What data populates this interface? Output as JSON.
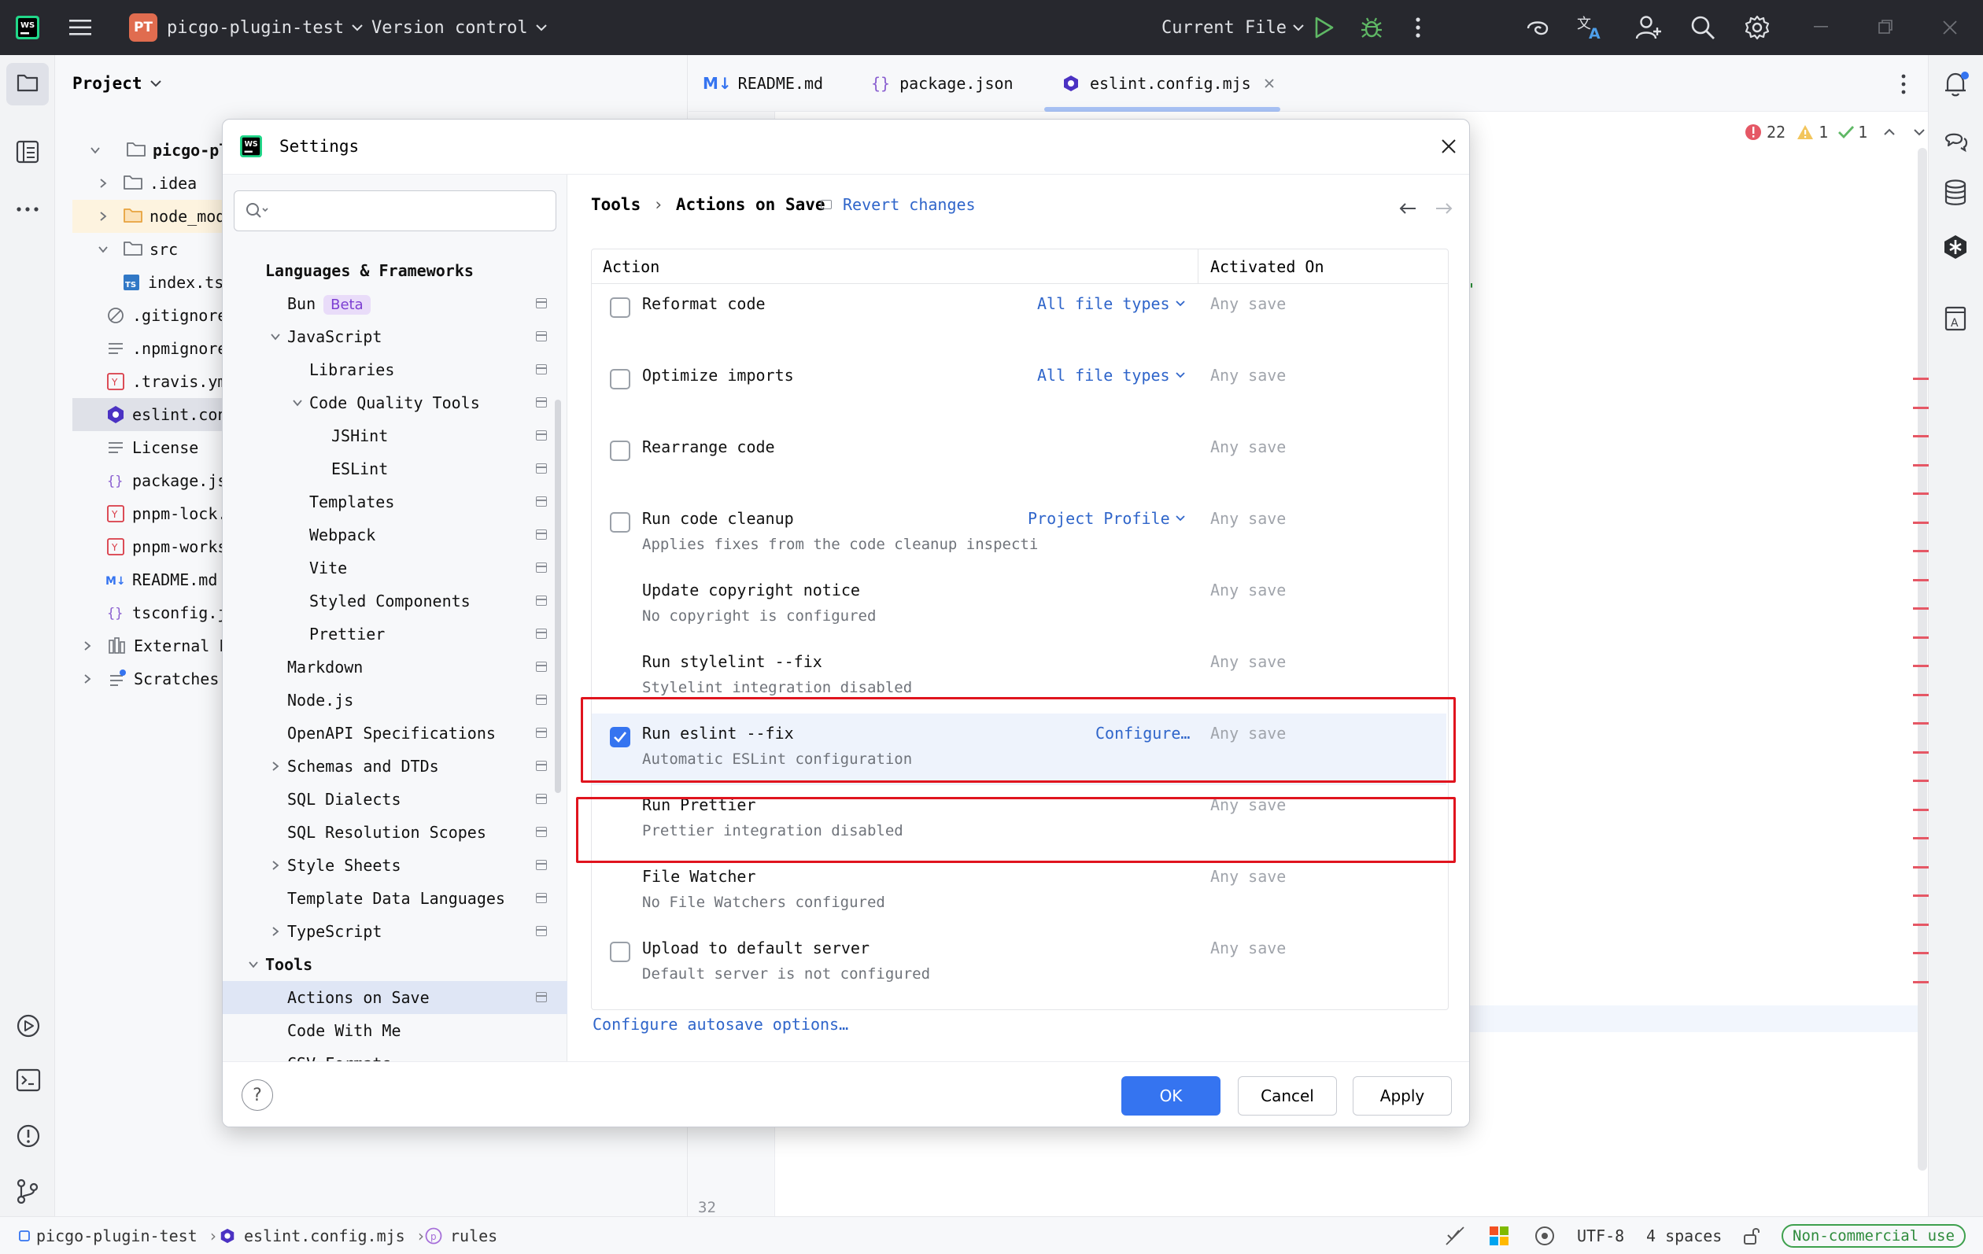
{
  "titlebar": {
    "project_badge": "PT",
    "project_name": "picgo-plugin-test",
    "vcs": "Version control",
    "run_config": "Current File"
  },
  "project_panel": {
    "title": "Project",
    "tree": [
      {
        "label": "picgo-plugi",
        "icon": "folder-icon",
        "bold": true
      },
      {
        "label": ".idea",
        "icon": "folder-icon"
      },
      {
        "label": "node_modul",
        "icon": "folder-orange-icon"
      },
      {
        "label": "src",
        "icon": "folder-icon"
      },
      {
        "label": "index.ts",
        "icon": "ts-file-icon"
      },
      {
        "label": ".gitignore",
        "icon": "ignore-file-icon"
      },
      {
        "label": ".npmignore",
        "icon": "text-file-icon"
      },
      {
        "label": ".travis.ym",
        "icon": "yaml-file-icon"
      },
      {
        "label": "eslint.con",
        "icon": "eslint-file-icon"
      },
      {
        "label": "License",
        "icon": "text-file-icon"
      },
      {
        "label": "package.js",
        "icon": "json-file-icon"
      },
      {
        "label": "pnpm-lock.",
        "icon": "yaml-file-icon"
      },
      {
        "label": "pnpm-works",
        "icon": "yaml-file-icon"
      },
      {
        "label": "README.md",
        "icon": "markdown-file-icon"
      },
      {
        "label": "tsconfig.j",
        "icon": "json-file-icon"
      },
      {
        "label": "External Li",
        "icon": "library-icon"
      },
      {
        "label": "Scratches a",
        "icon": "scratches-icon"
      }
    ]
  },
  "editor": {
    "tabs": [
      {
        "label": "README.md",
        "icon_text": "M↓"
      },
      {
        "label": "package.json",
        "icon_text": "{}"
      },
      {
        "label": "eslint.config.mjs",
        "icon_text": ""
      }
    ],
    "errors": "22",
    "warnings": "1",
    "weak_warnings": "1",
    "line_number": "32"
  },
  "dialog": {
    "title": "Settings",
    "search_placeholder": "",
    "breadcrumb_parent": "Tools",
    "breadcrumb_sep": "›",
    "breadcrumb_current": "Actions on Save",
    "revert_label": "Revert changes",
    "nav": [
      {
        "label": "Languages & Frameworks",
        "indent": 0,
        "bold": true,
        "pin": false,
        "chevron": "none"
      },
      {
        "label": "Bun",
        "indent": 1,
        "badge": "Beta",
        "pin": true,
        "chevron": "none"
      },
      {
        "label": "JavaScript",
        "indent": 1,
        "pin": true,
        "chevron": "down"
      },
      {
        "label": "Libraries",
        "indent": 2,
        "pin": true,
        "chevron": "none"
      },
      {
        "label": "Code Quality Tools",
        "indent": 2,
        "pin": true,
        "chevron": "down"
      },
      {
        "label": "JSHint",
        "indent": 3,
        "pin": true,
        "chevron": "none"
      },
      {
        "label": "ESLint",
        "indent": 3,
        "pin": true,
        "chevron": "none"
      },
      {
        "label": "Templates",
        "indent": 2,
        "pin": true,
        "chevron": "none"
      },
      {
        "label": "Webpack",
        "indent": 2,
        "pin": true,
        "chevron": "none"
      },
      {
        "label": "Vite",
        "indent": 2,
        "pin": true,
        "chevron": "none"
      },
      {
        "label": "Styled Components",
        "indent": 2,
        "pin": true,
        "chevron": "none"
      },
      {
        "label": "Prettier",
        "indent": 2,
        "pin": true,
        "chevron": "none"
      },
      {
        "label": "Markdown",
        "indent": 1,
        "pin": true,
        "chevron": "none"
      },
      {
        "label": "Node.js",
        "indent": 1,
        "pin": true,
        "chevron": "none"
      },
      {
        "label": "OpenAPI Specifications",
        "indent": 1,
        "pin": true,
        "chevron": "none"
      },
      {
        "label": "Schemas and DTDs",
        "indent": 1,
        "pin": true,
        "chevron": "right"
      },
      {
        "label": "SQL Dialects",
        "indent": 1,
        "pin": true,
        "chevron": "none"
      },
      {
        "label": "SQL Resolution Scopes",
        "indent": 1,
        "pin": true,
        "chevron": "none"
      },
      {
        "label": "Style Sheets",
        "indent": 1,
        "pin": true,
        "chevron": "right"
      },
      {
        "label": "Template Data Languages",
        "indent": 1,
        "pin": true,
        "chevron": "none"
      },
      {
        "label": "TypeScript",
        "indent": 1,
        "pin": true,
        "chevron": "right"
      },
      {
        "label": "Tools",
        "indent": 0,
        "bold": true,
        "pin": false,
        "chevron": "down"
      },
      {
        "label": "Actions on Save",
        "indent": 1,
        "pin": true,
        "chevron": "none",
        "selected": true
      },
      {
        "label": "Code With Me",
        "indent": 1,
        "pin": false,
        "chevron": "none"
      },
      {
        "label": "CSV Formats",
        "indent": 1,
        "pin": false,
        "chevron": "none"
      }
    ],
    "table": {
      "col_action": "Action",
      "col_activated": "Activated On",
      "rows": [
        {
          "title": "Reformat code",
          "subtitle": "",
          "checkbox": "unchecked",
          "option": "All file types",
          "option_dropdown": true,
          "activated": "Any save"
        },
        {
          "title": "Optimize imports",
          "subtitle": "",
          "checkbox": "unchecked",
          "option": "All file types",
          "option_dropdown": true,
          "activated": "Any save"
        },
        {
          "title": "Rearrange code",
          "subtitle": "",
          "checkbox": "unchecked",
          "option": "",
          "option_dropdown": false,
          "activated": "Any save"
        },
        {
          "title": "Run code cleanup",
          "subtitle": "Applies fixes from the code cleanup inspecti",
          "checkbox": "unchecked",
          "option": "Project Profile",
          "option_dropdown": true,
          "activated": "Any save"
        },
        {
          "title": "Update copyright notice",
          "subtitle": "No copyright is configured",
          "checkbox": "none",
          "option": "",
          "option_dropdown": false,
          "activated": "Any save"
        },
        {
          "title": "Run stylelint --fix",
          "subtitle": "Stylelint integration disabled",
          "checkbox": "none",
          "option": "",
          "option_dropdown": false,
          "activated": "Any save"
        },
        {
          "title": "Run eslint --fix",
          "subtitle": "Automatic ESLint configuration",
          "checkbox": "checked",
          "option": "Configure…",
          "option_dropdown": false,
          "activated": "Any save",
          "selected": true
        },
        {
          "title": "Run Prettier",
          "subtitle": "Prettier integration disabled",
          "checkbox": "none",
          "option": "",
          "option_dropdown": false,
          "activated": "Any save"
        },
        {
          "title": "File Watcher",
          "subtitle": "No File Watchers configured",
          "checkbox": "none",
          "option": "",
          "option_dropdown": false,
          "activated": "Any save"
        },
        {
          "title": "Upload to default server",
          "subtitle": "Default server is not configured",
          "checkbox": "unchecked",
          "option": "",
          "option_dropdown": false,
          "activated": "Any save"
        }
      ]
    },
    "autosave_link": "Configure autosave options…",
    "buttons": {
      "ok": "OK",
      "cancel": "Cancel",
      "apply": "Apply"
    }
  },
  "statusbar": {
    "crumbs": [
      "picgo-plugin-test",
      "eslint.config.mjs",
      "rules"
    ],
    "encoding": "UTF-8",
    "indent": "4 spaces",
    "license": "Non-commercial use"
  },
  "colors": {
    "accent": "#3574f0",
    "link": "#2f65ca",
    "highlight_box": "#e0141e",
    "titlebar": "#27282e"
  }
}
